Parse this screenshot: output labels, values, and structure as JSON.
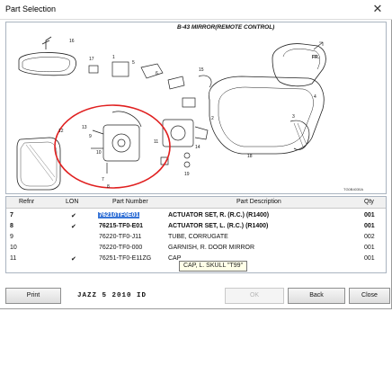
{
  "window": {
    "title": "Part Selection",
    "close_glyph": "✕"
  },
  "diagram": {
    "title": "B-43 MIRROR(REMOTE CONTROL)",
    "code": "TG0B4030A",
    "fr_label": "FR.",
    "callouts": [
      "16",
      "17",
      "1",
      "5",
      "6",
      "15",
      "2",
      "14",
      "3",
      "18",
      "4",
      "12",
      "13",
      "7",
      "8",
      "9",
      "10",
      "11",
      "19"
    ],
    "highlight_color": "#e02020"
  },
  "grid": {
    "headers": [
      "Refnr",
      "LON",
      "Part Number",
      "Part Description",
      "Qty"
    ],
    "rows": [
      {
        "refnr": "7",
        "lon": "✔",
        "part_number": "76210TF0E01",
        "description": "ACTUATOR SET, R. (R.C.) (R1400)",
        "qty": "001",
        "bold": true,
        "selected": true
      },
      {
        "refnr": "8",
        "lon": "✔",
        "part_number": "76215-TF0-E01",
        "description": "ACTUATOR SET, L. (R.C.) (R1400)",
        "qty": "001",
        "bold": true,
        "selected": false
      },
      {
        "refnr": "9",
        "lon": "",
        "part_number": "76220-TF0-J11",
        "description": "TUBE, CORRUGATE",
        "qty": "002",
        "bold": false,
        "selected": false
      },
      {
        "refnr": "10",
        "lon": "",
        "part_number": "76220-TF0-000",
        "description": "GARNISH, R. DOOR MIRROR",
        "qty": "001",
        "bold": false,
        "selected": false
      },
      {
        "refnr": "11",
        "lon": "✔",
        "part_number": "76251-TF0-E11ZG",
        "description": "CAP",
        "qty": "001",
        "bold": false,
        "selected": false
      }
    ],
    "tooltip": "CAP, L. SKULL \"T99\""
  },
  "footer": {
    "print_label": "Print",
    "model_text": "JAZZ  5  2010  ID",
    "ok_label": "OK",
    "back_label": "Back",
    "close_label": "Close"
  }
}
